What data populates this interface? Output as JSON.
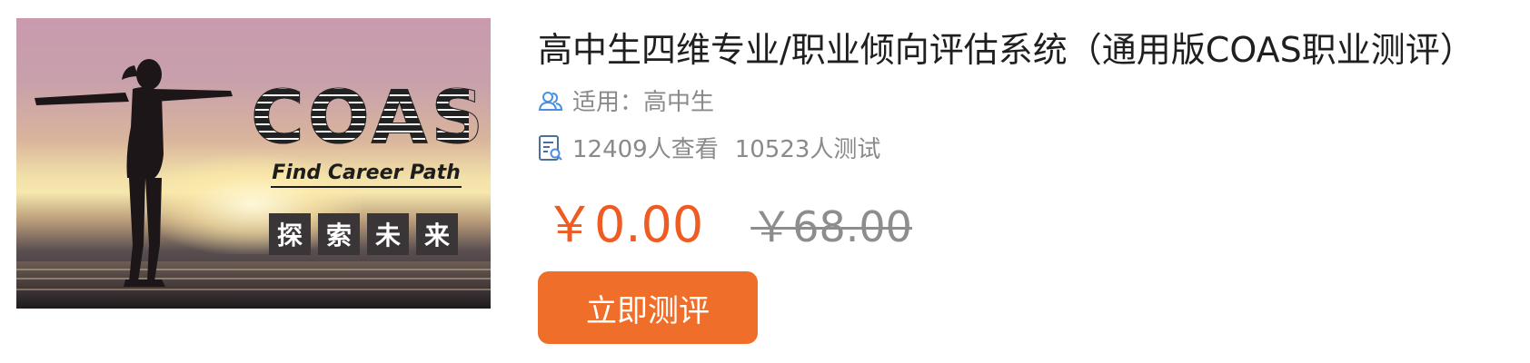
{
  "banner": {
    "logo_text": "COAS",
    "tagline": "Find Career Path",
    "chars": [
      "探",
      "索",
      "未",
      "来"
    ]
  },
  "product": {
    "title": "高中生四维专业/职业倾向评估系统（通用版COAS职业测评）",
    "audience": "适用：高中生",
    "views": "12409人查看",
    "tests": "10523人测试",
    "price_now": "￥0.00",
    "price_original": "￥68.00",
    "cta_label": "立即测评"
  },
  "icons": {
    "audience": "users-icon",
    "stats": "report-search-icon"
  },
  "colors": {
    "accent": "#ef5b22",
    "button": "#ef6e2a",
    "muted": "#8a8a8a",
    "icon_blue": "#4a90e2"
  }
}
